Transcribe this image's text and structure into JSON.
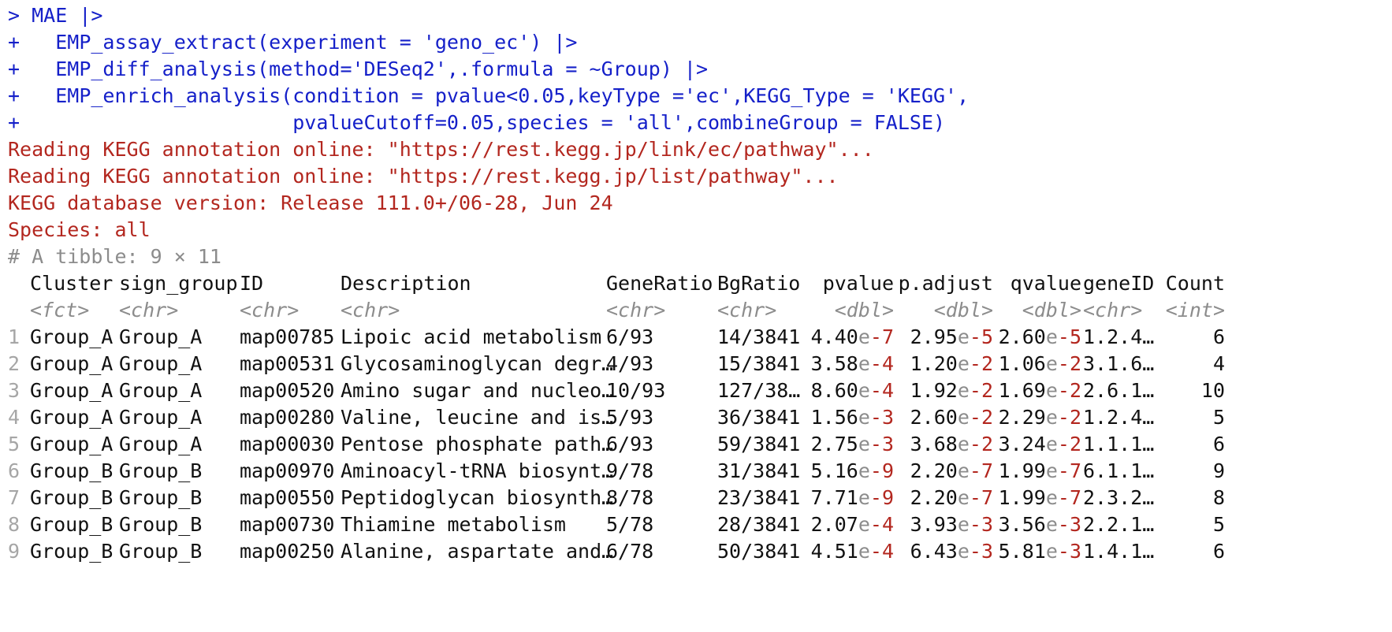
{
  "console": {
    "command_lines": [
      {
        "prompt": ">",
        "text": " MAE |>"
      },
      {
        "prompt": "+",
        "text": "   EMP_assay_extract(experiment = 'geno_ec') |>"
      },
      {
        "prompt": "+",
        "text": "   EMP_diff_analysis(method='DESeq2',.formula = ~Group) |>"
      },
      {
        "prompt": "+",
        "text": "   EMP_enrich_analysis(condition = pvalue<0.05,keyType ='ec',KEGG_Type = 'KEGG',"
      },
      {
        "prompt": "+",
        "text": "                       pvalueCutoff=0.05,species = 'all',combineGroup = FALSE)"
      }
    ],
    "messages": [
      "Reading KEGG annotation online: \"https://rest.kegg.jp/link/ec/pathway\"...",
      "Reading KEGG annotation online: \"https://rest.kegg.jp/list/pathway\"...",
      "KEGG database version: Release 111.0+/06-28, Jun 24",
      "Species: all"
    ],
    "tibble_header": "# A tibble: 9 × 11",
    "table": {
      "columns": [
        "Cluster",
        "sign_group",
        "ID",
        "Description",
        "GeneRatio",
        "BgRatio",
        "pvalue",
        "p.adjust",
        "qvalue",
        "geneID",
        "Count"
      ],
      "types": [
        "<fct>",
        "<chr>",
        "<chr>",
        "<chr>",
        "<chr>",
        "<chr>",
        "<dbl>",
        "<dbl>",
        "<dbl>",
        "<chr>",
        "<int>"
      ],
      "rows": [
        {
          "n": "1",
          "Cluster": "Group_A",
          "sign_group": "Group_A",
          "ID": "map00785",
          "Description": "Lipoic acid metabolism",
          "GeneRatio": "6/93",
          "BgRatio": "14/3841",
          "pvalue": [
            "4.40",
            "e-7"
          ],
          "p_adjust": [
            "2.95",
            "e-5"
          ],
          "qvalue": [
            "2.60",
            "e-5"
          ],
          "geneID": "1.2.4…",
          "Count": "6"
        },
        {
          "n": "2",
          "Cluster": "Group_A",
          "sign_group": "Group_A",
          "ID": "map00531",
          "Description": "Glycosaminoglycan degr…",
          "GeneRatio": "4/93",
          "BgRatio": "15/3841",
          "pvalue": [
            "3.58",
            "e-4"
          ],
          "p_adjust": [
            "1.20",
            "e-2"
          ],
          "qvalue": [
            "1.06",
            "e-2"
          ],
          "geneID": "3.1.6…",
          "Count": "4"
        },
        {
          "n": "3",
          "Cluster": "Group_A",
          "sign_group": "Group_A",
          "ID": "map00520",
          "Description": "Amino sugar and nucleo…",
          "GeneRatio": "10/93",
          "BgRatio": "127/38…",
          "pvalue": [
            "8.60",
            "e-4"
          ],
          "p_adjust": [
            "1.92",
            "e-2"
          ],
          "qvalue": [
            "1.69",
            "e-2"
          ],
          "geneID": "2.6.1…",
          "Count": "10"
        },
        {
          "n": "4",
          "Cluster": "Group_A",
          "sign_group": "Group_A",
          "ID": "map00280",
          "Description": "Valine, leucine and is…",
          "GeneRatio": "5/93",
          "BgRatio": "36/3841",
          "pvalue": [
            "1.56",
            "e-3"
          ],
          "p_adjust": [
            "2.60",
            "e-2"
          ],
          "qvalue": [
            "2.29",
            "e-2"
          ],
          "geneID": "1.2.4…",
          "Count": "5"
        },
        {
          "n": "5",
          "Cluster": "Group_A",
          "sign_group": "Group_A",
          "ID": "map00030",
          "Description": "Pentose phosphate path…",
          "GeneRatio": "6/93",
          "BgRatio": "59/3841",
          "pvalue": [
            "2.75",
            "e-3"
          ],
          "p_adjust": [
            "3.68",
            "e-2"
          ],
          "qvalue": [
            "3.24",
            "e-2"
          ],
          "geneID": "1.1.1…",
          "Count": "6"
        },
        {
          "n": "6",
          "Cluster": "Group_B",
          "sign_group": "Group_B",
          "ID": "map00970",
          "Description": "Aminoacyl-tRNA biosynt…",
          "GeneRatio": "9/78",
          "BgRatio": "31/3841",
          "pvalue": [
            "5.16",
            "e-9"
          ],
          "p_adjust": [
            "2.20",
            "e-7"
          ],
          "qvalue": [
            "1.99",
            "e-7"
          ],
          "geneID": "6.1.1…",
          "Count": "9"
        },
        {
          "n": "7",
          "Cluster": "Group_B",
          "sign_group": "Group_B",
          "ID": "map00550",
          "Description": "Peptidoglycan biosynth…",
          "GeneRatio": "8/78",
          "BgRatio": "23/3841",
          "pvalue": [
            "7.71",
            "e-9"
          ],
          "p_adjust": [
            "2.20",
            "e-7"
          ],
          "qvalue": [
            "1.99",
            "e-7"
          ],
          "geneID": "2.3.2…",
          "Count": "8"
        },
        {
          "n": "8",
          "Cluster": "Group_B",
          "sign_group": "Group_B",
          "ID": "map00730",
          "Description": "Thiamine metabolism",
          "GeneRatio": "5/78",
          "BgRatio": "28/3841",
          "pvalue": [
            "2.07",
            "e-4"
          ],
          "p_adjust": [
            "3.93",
            "e-3"
          ],
          "qvalue": [
            "3.56",
            "e-3"
          ],
          "geneID": "2.2.1…",
          "Count": "5"
        },
        {
          "n": "9",
          "Cluster": "Group_B",
          "sign_group": "Group_B",
          "ID": "map00250",
          "Description": "Alanine, aspartate and…",
          "GeneRatio": "6/78",
          "BgRatio": "50/3841",
          "pvalue": [
            "4.51",
            "e-4"
          ],
          "p_adjust": [
            "6.43",
            "e-3"
          ],
          "qvalue": [
            "5.81",
            "e-3"
          ],
          "geneID": "1.4.1…",
          "Count": "6"
        }
      ]
    },
    "colors": {
      "command": "#1520c9",
      "message": "#b3271f",
      "meta": "#8c8c8c"
    }
  }
}
